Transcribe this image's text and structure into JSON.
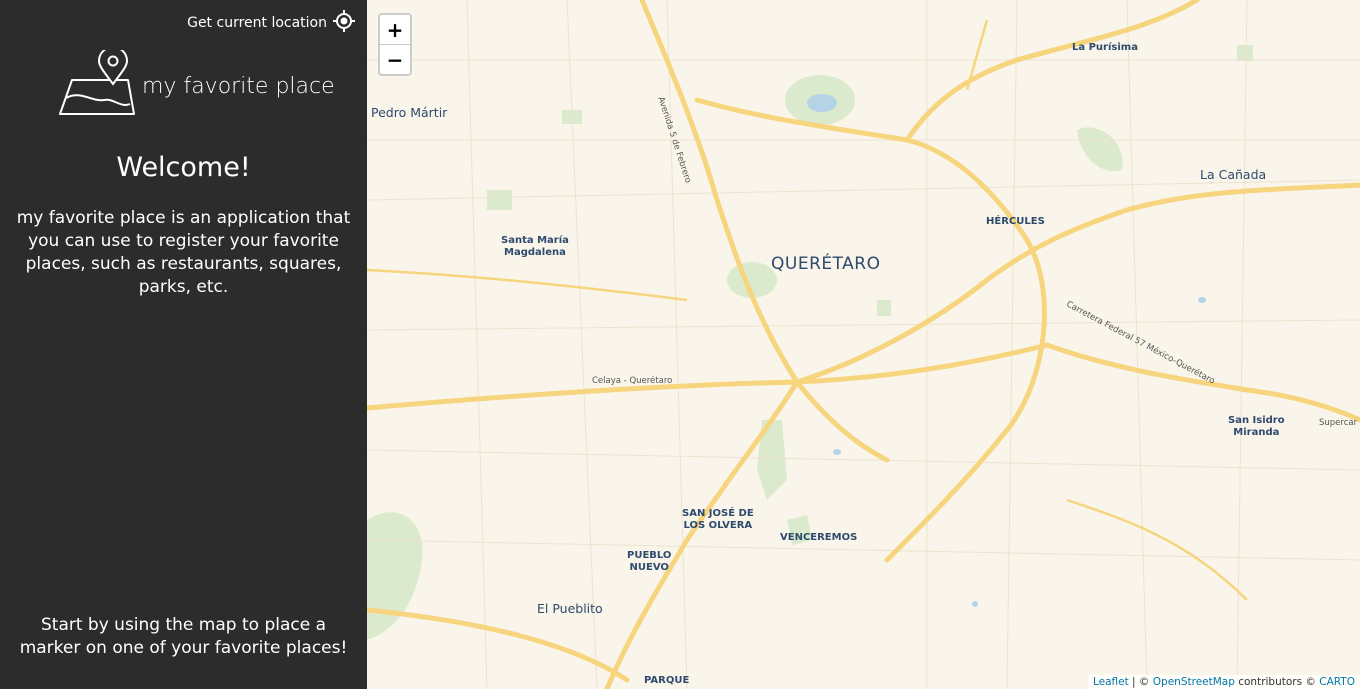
{
  "sidebar": {
    "geolocate_label": "Get current location",
    "brand_name": "my favorite place",
    "welcome_title": "Welcome!",
    "intro_text": "my favorite place is an application that you can use to register your favorite places, such as restaurants, squares, parks, etc.",
    "hint_text": "Start by using the map to place a marker on one of your favorite places!"
  },
  "map": {
    "zoom_in": "+",
    "zoom_out": "−",
    "labels": {
      "queretaro": "QUERÉTARO",
      "pedro_martir": "Pedro Mártir",
      "la_purisima": "La Purísima",
      "la_canada": "La Cañada",
      "hercules": "HÉRCULES",
      "santa_maria_1": "Santa María",
      "santa_maria_2": "Magdalena",
      "san_isidro_1": "San Isidro",
      "san_isidro_2": "Miranda",
      "san_jose_1": "SAN JOSÉ DE",
      "san_jose_2": "LOS OLVERA",
      "pueblo_nuevo_1": "PUEBLO",
      "pueblo_nuevo_2": "NUEVO",
      "venceremos": "VENCEREMOS",
      "el_pueblito": "El Pueblito",
      "parque": "PARQUE",
      "avenida": "Avenida 5 de Febrero",
      "celaya": "Celaya - Querétaro",
      "carretera": "Carretera Federal 57 México-Querétaro",
      "supercar": "Supercar"
    },
    "attribution": {
      "leaflet": "Leaflet",
      "sep1": " | © ",
      "osm": "OpenStreetMap",
      "contrib": " contributors © ",
      "carto": "CARTO"
    }
  },
  "colors": {
    "sidebar_bg": "#2c2c2c",
    "map_bg": "#faf5ea",
    "road": "#f7d57f",
    "park": "#dbeacd",
    "water": "#b5d3e7",
    "label": "#2e4a6e",
    "link": "#0078a8"
  }
}
